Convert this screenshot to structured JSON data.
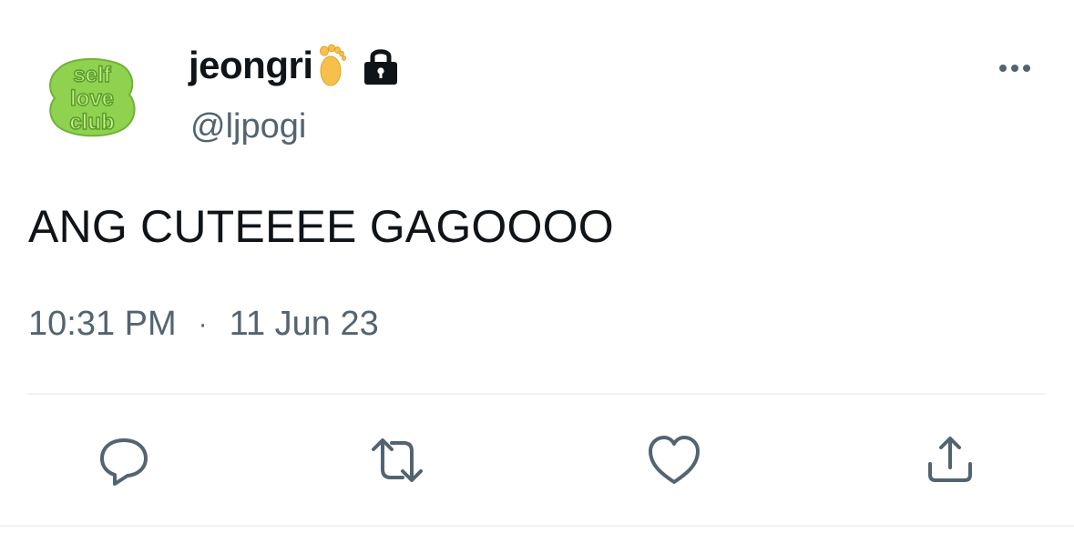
{
  "user": {
    "display_name": "jeongri",
    "name_emoji": "foot-emoji",
    "protected_icon": "lock-icon",
    "handle": "@ljpogi",
    "avatar": {
      "icon": "self-love-club-avatar",
      "text_lines": [
        "self",
        "love",
        "club"
      ],
      "color": "#8fd24f"
    }
  },
  "tweet": {
    "text": "ANG CUTEEEE GAGOOOO",
    "time": "10:31 PM",
    "separator": "·",
    "date": "11 Jun 23"
  },
  "menu": {
    "icon": "more-icon"
  },
  "actions": [
    {
      "name": "reply",
      "icon": "reply-icon"
    },
    {
      "name": "retweet",
      "icon": "retweet-icon"
    },
    {
      "name": "like",
      "icon": "heart-icon"
    },
    {
      "name": "share",
      "icon": "share-icon"
    }
  ],
  "colors": {
    "text_primary": "#0f1419",
    "text_secondary": "#536471",
    "divider": "#eff3f4",
    "avatar_green": "#8fd24f"
  }
}
